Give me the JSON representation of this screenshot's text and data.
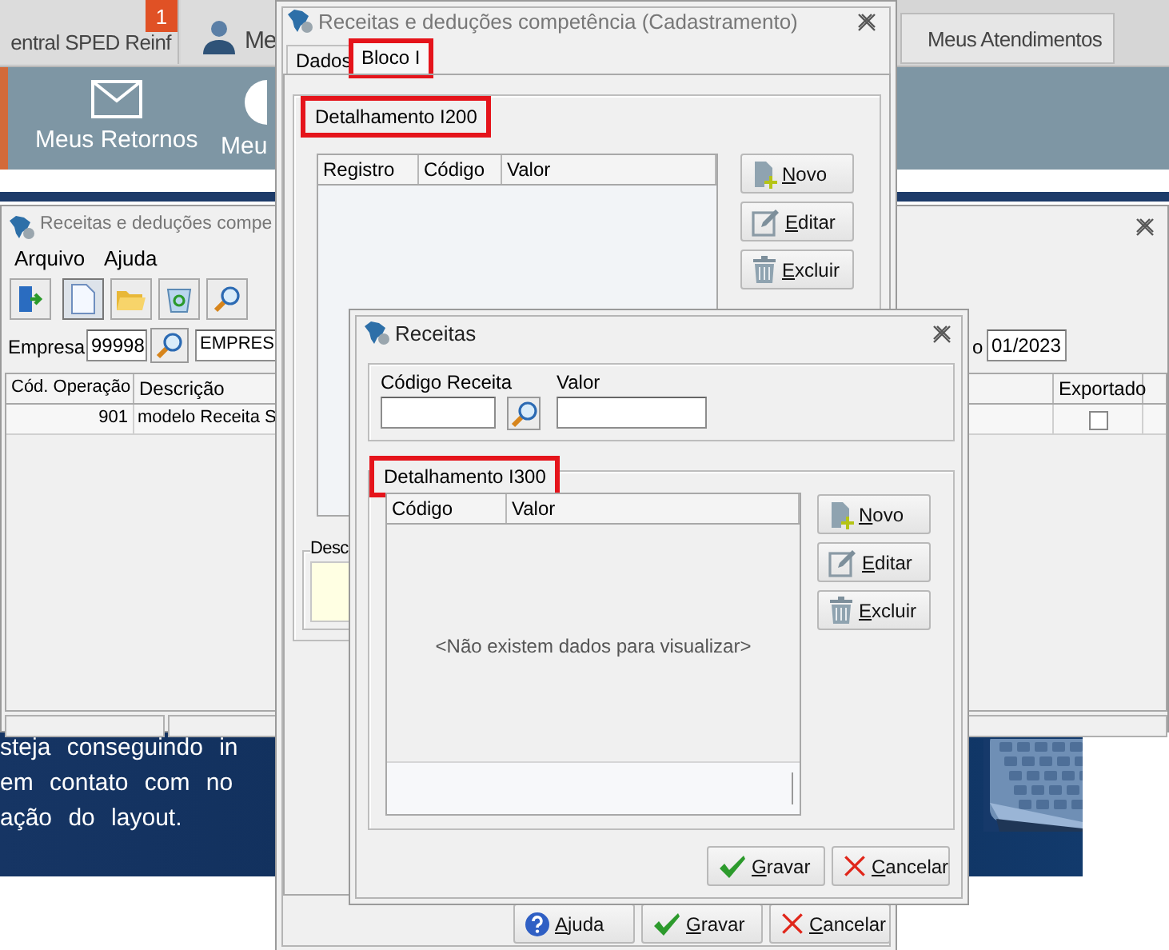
{
  "web_page": {
    "tabs": [
      {
        "label": "entral SPED Reinf",
        "badge": "1",
        "selected": false
      },
      {
        "label": "Me",
        "selected": false
      },
      {
        "label": "Meus Atendimentos",
        "selected": true
      }
    ],
    "toolbar": [
      {
        "label": "Meus Retornos"
      },
      {
        "label": "Meu"
      }
    ],
    "banner": {
      "lines": [
        "steja conseguindo in",
        "em contato com no",
        "ação do layout."
      ]
    }
  },
  "back_window": {
    "title": "Receitas e deduções compe",
    "menu": [
      "Arquivo",
      "Ajuda"
    ],
    "empresa": {
      "label": "Empresa",
      "code": "99998",
      "name": "EMPRES"
    },
    "period": {
      "label": "o",
      "value": "01/2023"
    },
    "table": {
      "columns": [
        "Cód. Operação",
        "Descrição"
      ],
      "last_column": "Exportado",
      "rows": [
        {
          "code": "901",
          "description": "modelo Receita S",
          "exported": false
        }
      ]
    }
  },
  "main_dialog": {
    "title": "Receitas e deduções competência (Cadastramento)",
    "tabs": [
      {
        "label": "Dados",
        "selected": false,
        "highlighted": false
      },
      {
        "label": "Bloco I",
        "selected": true,
        "highlighted": true
      }
    ],
    "group": {
      "title": "Detalhamento I200",
      "highlighted": true,
      "columns": [
        "Registro",
        "Código",
        "Valor"
      ],
      "buttons": [
        {
          "label": "Novo",
          "kind": "new"
        },
        {
          "label": "Editar",
          "kind": "edit"
        },
        {
          "label": "Excluir",
          "kind": "delete"
        }
      ]
    },
    "description_group": {
      "title": "Desc"
    },
    "buttons": [
      {
        "label": "Ajuda",
        "kind": "help"
      },
      {
        "label": "Gravar",
        "kind": "save"
      },
      {
        "label": "Cancelar",
        "kind": "cancel"
      }
    ]
  },
  "receitas_dialog": {
    "title": "Receitas",
    "fields": [
      {
        "label": "Código Receita",
        "lookup": true
      },
      {
        "label": "Valor",
        "lookup": false
      }
    ],
    "group": {
      "title": "Detalhamento I300",
      "highlighted": true,
      "columns": [
        "Código",
        "Valor"
      ],
      "empty_message": "<Não existem dados para visualizar>",
      "buttons": [
        {
          "label": "Novo",
          "kind": "new"
        },
        {
          "label": "Editar",
          "kind": "edit"
        },
        {
          "label": "Excluir",
          "kind": "delete"
        }
      ]
    },
    "buttons": [
      {
        "label": "Gravar",
        "kind": "save"
      },
      {
        "label": "Cancelar",
        "kind": "cancel"
      }
    ]
  }
}
